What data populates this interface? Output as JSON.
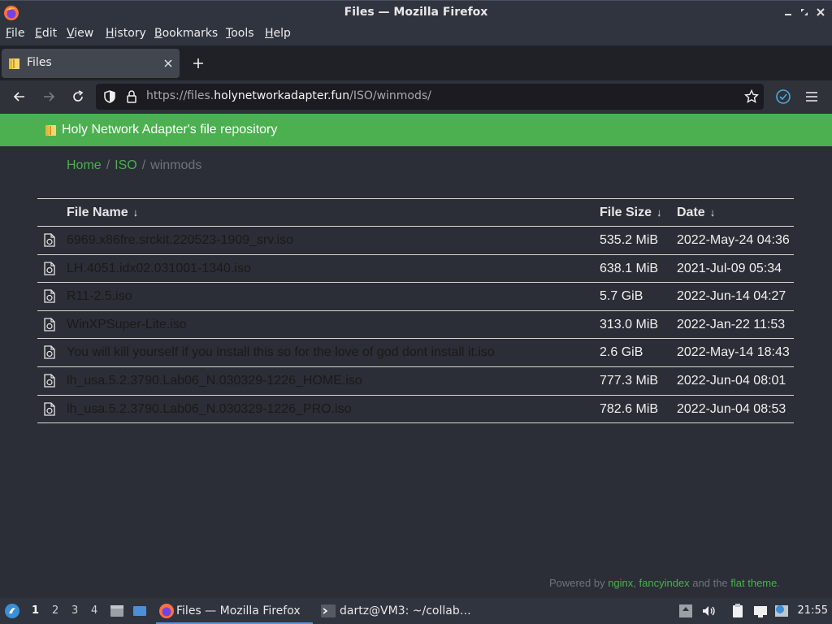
{
  "window": {
    "title": "Files — Mozilla Firefox"
  },
  "menu": {
    "items": [
      "File",
      "Edit",
      "View",
      "History",
      "Bookmarks",
      "Tools",
      "Help"
    ]
  },
  "tab": {
    "label": "Files"
  },
  "urlbar": {
    "prefix": "https://files.",
    "domain": "holynetworkadapter.fun",
    "path": "/ISO/winmods/"
  },
  "banner": {
    "text": "Holy Network Adapter's file repository"
  },
  "breadcrumb": {
    "home": "Home",
    "sep": "/",
    "iso": "ISO",
    "current": "winmods"
  },
  "table": {
    "headers": {
      "name": "File Name",
      "size": "File Size",
      "date": "Date",
      "arrow": "↓"
    },
    "rows": [
      {
        "name": "6969.x86fre.srckit.220523-1909_srv.iso",
        "size": "535.2 MiB",
        "date": "2022-May-24 04:36"
      },
      {
        "name": "LH.4051.idx02.031001-1340.iso",
        "size": "638.1 MiB",
        "date": "2021-Jul-09 05:34"
      },
      {
        "name": "R11-2.5.iso",
        "size": "5.7 GiB",
        "date": "2022-Jun-14 04:27"
      },
      {
        "name": "WinXPSuper-Lite.iso",
        "size": "313.0 MiB",
        "date": "2022-Jan-22 11:53"
      },
      {
        "name": "You will kill yourself if you install this so for the love of god dont install it.iso",
        "size": "2.6 GiB",
        "date": "2022-May-14 18:43"
      },
      {
        "name": "lh_usa.5.2.3790.Lab06_N.030329-1226_HOME.iso",
        "size": "777.3 MiB",
        "date": "2022-Jun-04 08:01"
      },
      {
        "name": "lh_usa.5.2.3790.Lab06_N.030329-1226_PRO.iso",
        "size": "782.6 MiB",
        "date": "2022-Jun-04 08:53"
      }
    ]
  },
  "footer": {
    "prefix": "Powered by ",
    "nginx": "nginx",
    "comma": ", ",
    "fancyindex": "fancyindex",
    "mid": " and the ",
    "flat": "flat theme",
    "end": "."
  },
  "taskbar": {
    "workspaces": [
      "1",
      "2",
      "3",
      "4"
    ],
    "firefox_label": "Files — Mozilla Firefox",
    "terminal_label": "dartz@VM3: ~/collab…",
    "clock": "21:55"
  },
  "colors": {
    "accent_green": "#4caf50",
    "taskbar_active": "#5294e2",
    "account_blue": "#4aa8e0"
  },
  "icons": {
    "file": "file-document-icon",
    "folder": "folder-icon",
    "shield": "shield-icon",
    "lock": "lock-icon",
    "star": "bookmark-star-icon"
  }
}
